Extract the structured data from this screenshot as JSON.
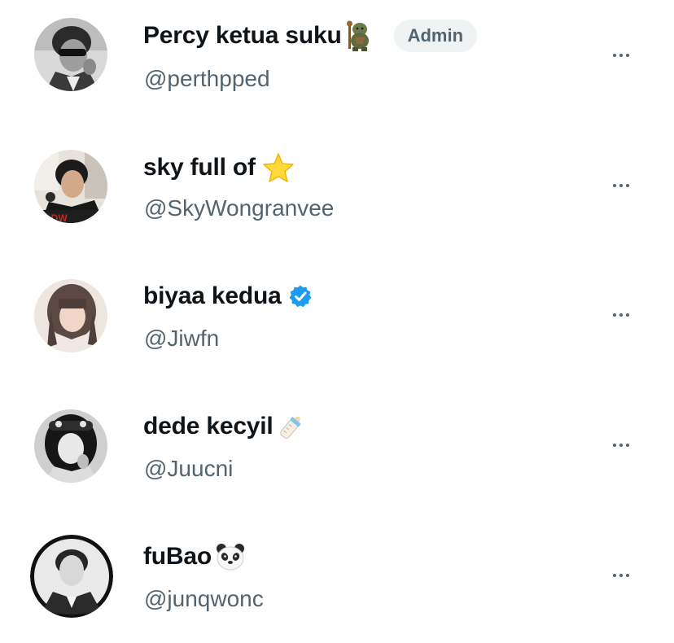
{
  "members": [
    {
      "display_name": "Percy ketua suku",
      "handle": "@perthpped",
      "name_icon": "troll-emoji-icon",
      "badge": "Admin",
      "avatar": "avatar-man-sunglasses-bw"
    },
    {
      "display_name": "sky full of",
      "handle": "@SkyWongranvee",
      "name_icon": "star-emoji-icon",
      "avatar": "avatar-man-black-tshirt"
    },
    {
      "display_name": "biyaa kedua",
      "handle": "@Jiwfn",
      "name_icon": "verified-badge-icon",
      "avatar": "avatar-woman-bangs"
    },
    {
      "display_name": "dede kecyil",
      "handle": "@Juucni",
      "name_icon": "baby-bottle-emoji-icon",
      "avatar": "avatar-woman-headband-bw"
    },
    {
      "display_name": "fuBao",
      "handle": "@junqwonc",
      "name_icon": "panda-emoji-icon",
      "avatar": "avatar-man-suit-bw"
    }
  ],
  "colors": {
    "name_text": "#0f1419",
    "handle_text": "#536471",
    "badge_bg": "#eff3f4",
    "verified_blue": "#1d9bf0"
  }
}
